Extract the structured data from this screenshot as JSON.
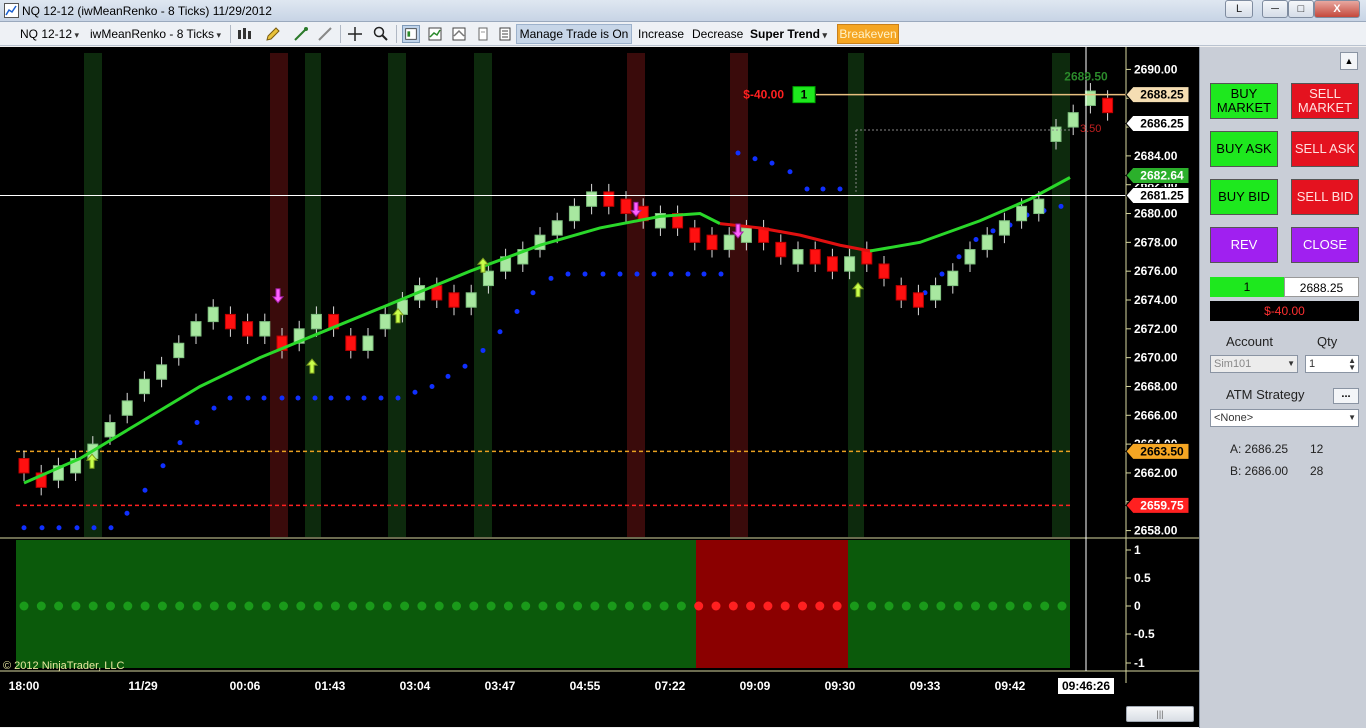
{
  "window": {
    "title": "NQ 12-12 (iwMeanRenko - 8 Ticks)  11/29/2012",
    "link_button": "L",
    "minimize": "─",
    "maximize": "□",
    "close": "X"
  },
  "toolbar": {
    "instrument": "NQ 12-12",
    "bar_type": "iwMeanRenko - 8 Ticks",
    "manage_trade": "Manage Trade is On",
    "increase": "Increase",
    "decrease": "Decrease",
    "super_trend": "Super Trend",
    "breakeven": "Breakeven"
  },
  "chart": {
    "copyright": "© 2012 NinjaTrader, LLC",
    "price_axis": [
      "2690.00",
      "2688.00",
      "2686.00",
      "2684.00",
      "2682.00",
      "2680.00",
      "2678.00",
      "2676.00",
      "2674.00",
      "2672.00",
      "2670.00",
      "2668.00",
      "2666.00",
      "2664.00",
      "2662.00",
      "2660.00",
      "2658.00"
    ],
    "time_axis": [
      "18:00",
      "11/29",
      "00:06",
      "01:43",
      "03:04",
      "03:47",
      "04:55",
      "07:22",
      "09:09",
      "09:30",
      "09:33",
      "09:42"
    ],
    "current_time": "09:46:26",
    "price_badges": {
      "last": "2688.25",
      "bid": "2686.25",
      "ask": "2682.64",
      "crosshair": "2681.25",
      "upper_line": "2663.50",
      "lower_line": "2659.75",
      "top_partial": "2689.50"
    },
    "position_pnl": "$-40.00",
    "position_qty": "1",
    "stop_marker": "3.50",
    "indicator_axis": [
      "1",
      "0.5",
      "0",
      "-0.5",
      "-1"
    ]
  },
  "chart_data": {
    "type": "candlestick",
    "y_range": [
      2657,
      2691
    ],
    "candles_approx_closes": [
      2662,
      2661,
      2662.5,
      2663,
      2664,
      2665.5,
      2667,
      2668.5,
      2669.5,
      2671,
      2672.5,
      2673.5,
      2672,
      2671.5,
      2672.5,
      2670.5,
      2672,
      2673,
      2672,
      2670.5,
      2671.5,
      2673,
      2674,
      2675,
      2674,
      2673.5,
      2674.5,
      2676,
      2677,
      2677.5,
      2678.5,
      2679.5,
      2680.5,
      2681.5,
      2680.5,
      2680,
      2679.5,
      2680,
      2679,
      2678,
      2677.5,
      2678.5,
      2679,
      2678,
      2677,
      2677.5,
      2676.5,
      2676,
      2677,
      2676.5,
      2675.5,
      2674,
      2673.5,
      2675,
      2676,
      2677.5,
      2678.5,
      2679.5,
      2680.5,
      2681,
      2686,
      2687,
      2688.5,
      2687
    ]
  },
  "panel": {
    "buy_market": "BUY MARKET",
    "sell_market": "SELL MARKET",
    "buy_ask": "BUY ASK",
    "sell_ask": "SELL ASK",
    "buy_bid": "BUY BID",
    "sell_bid": "SELL BID",
    "rev": "REV",
    "close": "CLOSE",
    "position_qty": "1",
    "position_price": "2688.25",
    "position_pnl": "$-40.00",
    "account_label": "Account",
    "qty_label": "Qty",
    "account_value": "Sim101",
    "qty_value": "1",
    "atm_label": "ATM Strategy",
    "atm_button": "...",
    "atm_value": "<None>",
    "ask_label": "A: 2686.25",
    "ask_size": "12",
    "bid_label": "B: 2686.00",
    "bid_size": "28"
  },
  "scroll": {
    "grip": "|||"
  }
}
